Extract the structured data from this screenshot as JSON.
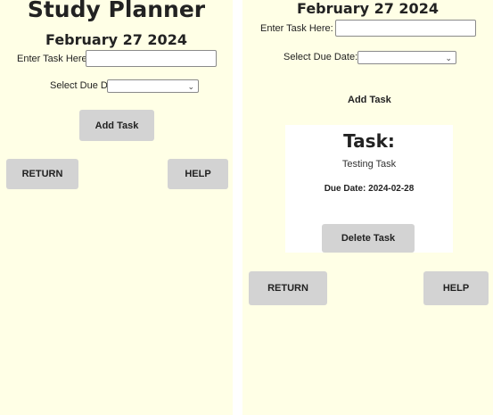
{
  "left": {
    "title": "Study Planner",
    "date": "February 27 2024",
    "task_label": "Enter Task Here:",
    "task_value": "",
    "due_label": "Select Due Date:",
    "due_value": "",
    "add_button": "Add Task",
    "return_button": "RETURN",
    "help_button": "HELP"
  },
  "right": {
    "date": "February 27 2024",
    "task_label": "Enter Task Here:",
    "task_value": "",
    "due_label": "Select Due Date:",
    "due_value": "",
    "add_button": "Add Task",
    "task_card": {
      "heading": "Task:",
      "name": "Testing Task",
      "due": "Due Date: 2024-02-28",
      "delete_button": "Delete Task"
    },
    "return_button": "RETURN",
    "help_button": "HELP"
  },
  "colors": {
    "background": "#ffffe6",
    "button": "#d3d3d3",
    "card": "#ffffff"
  }
}
